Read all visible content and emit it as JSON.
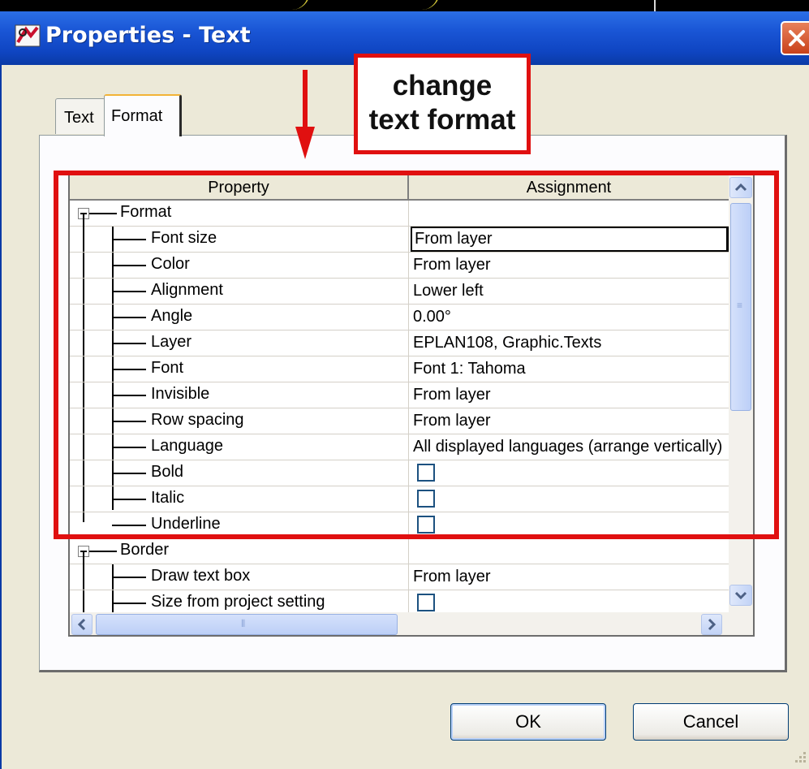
{
  "window": {
    "title": "Properties - Text",
    "accent": "#0f45c2",
    "close_icon": "close-x-icon"
  },
  "tabs": [
    {
      "label": "Text",
      "active": false
    },
    {
      "label": "Format",
      "active": true
    }
  ],
  "grid": {
    "columns": [
      "Property",
      "Assignment"
    ],
    "groups": [
      {
        "label": "Format",
        "expanded": true,
        "rows": [
          {
            "property": "Font size",
            "value": "From layer"
          },
          {
            "property": "Color",
            "value": "From layer"
          },
          {
            "property": "Alignment",
            "value": "Lower left"
          },
          {
            "property": "Angle",
            "value": "0.00°"
          },
          {
            "property": "Layer",
            "value": "EPLAN108, Graphic.Texts"
          },
          {
            "property": "Font",
            "value": "Font 1: Tahoma"
          },
          {
            "property": "Invisible",
            "value": "From layer"
          },
          {
            "property": "Row spacing",
            "value": "From layer"
          },
          {
            "property": "Language",
            "value": "All displayed languages (arrange vertically)"
          },
          {
            "property": "Bold",
            "checkbox": true,
            "checked": false
          },
          {
            "property": "Italic",
            "checkbox": true,
            "checked": false
          },
          {
            "property": "Underline",
            "checkbox": true,
            "checked": false
          }
        ]
      },
      {
        "label": "Border",
        "expanded": true,
        "rows": [
          {
            "property": "Draw text box",
            "value": "From layer"
          },
          {
            "property": "Size from project setting",
            "checkbox": true,
            "checked": false
          }
        ]
      }
    ]
  },
  "annotation": {
    "line1": "change",
    "line2": "text format",
    "color": "#e01010"
  },
  "buttons": {
    "ok": "OK",
    "cancel": "Cancel"
  }
}
